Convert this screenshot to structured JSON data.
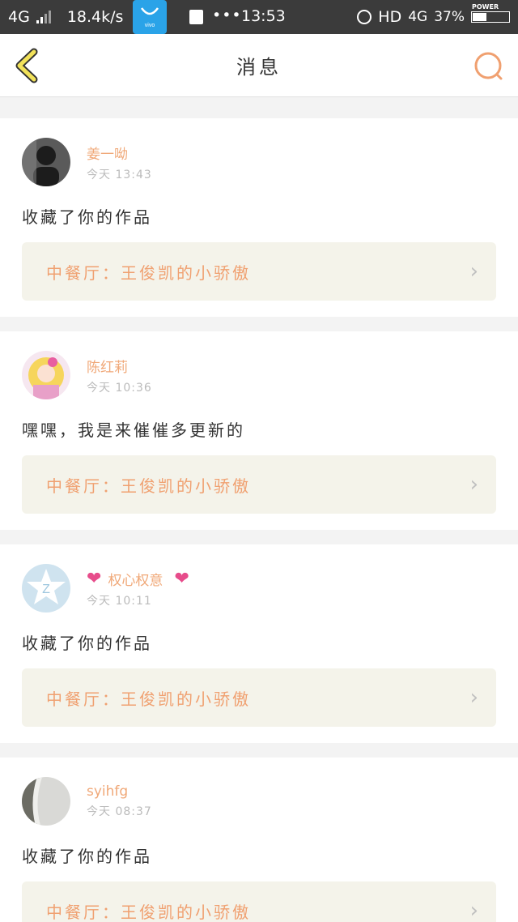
{
  "status_bar": {
    "network": "4G",
    "speed": "18.4k/s",
    "app_badge": "vivo",
    "dots": "•••",
    "time": "13:53",
    "hd": "HD",
    "network2": "4G",
    "battery_percent": "37%",
    "battery_label": "POWER",
    "battery_level": 0.37
  },
  "header": {
    "title": "消息",
    "back_icon": "chevron-left-icon",
    "search_icon": "search-icon"
  },
  "messages": [
    {
      "user": "姜一呦",
      "time": "今天 13:43",
      "text": "收藏了你的作品",
      "work_title": "中餐厅：王俊凯的小骄傲"
    },
    {
      "user": "陈红莉",
      "time": "今天 10:36",
      "text": "嘿嘿，我是来催催多更新的",
      "work_title": "中餐厅：王俊凯的小骄傲"
    },
    {
      "user": "权心权意",
      "time": "今天 10:11",
      "text": "收藏了你的作品",
      "work_title": "中餐厅：王俊凯的小骄傲"
    },
    {
      "user": "syihfg",
      "time": "今天 08:37",
      "text": "收藏了你的作品",
      "work_title": "中餐厅：王俊凯的小骄傲"
    }
  ],
  "colors": {
    "accent": "#f0a070",
    "heart": "#e74c8b",
    "status_bar_bg": "#3b3b3b",
    "card_ref_bg": "#f4f3ea"
  }
}
